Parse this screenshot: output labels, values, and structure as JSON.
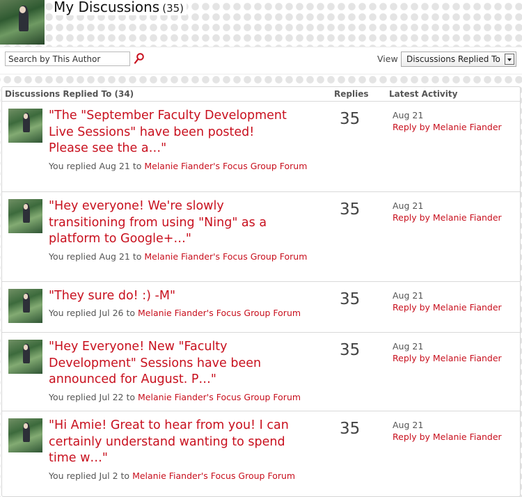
{
  "header": {
    "title": "My Discussions",
    "count": "(35)"
  },
  "toolbar": {
    "search_placeholder": "Search by This Author",
    "view_label": "View",
    "view_selected": "Discussions Replied To"
  },
  "table": {
    "header_topic": "Discussions Replied To (34)",
    "header_replies": "Replies",
    "header_activity": "Latest Activity"
  },
  "rows": [
    {
      "title_lines": [
        "\"The \"September Faculty Development",
        "Live Sessions\" have been posted!",
        "Please see the a…\""
      ],
      "meta_prefix": "You replied Aug 21 to ",
      "forum": "Melanie Fiander's Focus Group Forum",
      "replies": "35",
      "activity_date": "Aug 21",
      "activity_reply": "Reply by Melanie Fiander"
    },
    {
      "title_lines": [
        "\"Hey everyone! We're slowly",
        "transitioning from using \"Ning\" as a",
        "platform to Google+…\""
      ],
      "meta_prefix": "You replied Aug 21 to ",
      "forum": "Melanie Fiander's Focus Group Forum",
      "replies": "35",
      "activity_date": "Aug 21",
      "activity_reply": "Reply by Melanie Fiander"
    },
    {
      "title_lines": [
        "\"They sure do! :) -M\""
      ],
      "meta_prefix": "You replied Jul 26 to ",
      "forum": "Melanie Fiander's Focus Group Forum",
      "replies": "35",
      "activity_date": "Aug 21",
      "activity_reply": "Reply by Melanie Fiander"
    },
    {
      "title_lines": [
        "\"Hey Everyone! New \"Faculty",
        "Development\" Sessions have been",
        "announced for August.  P…\""
      ],
      "meta_prefix": "You replied Jul 22 to ",
      "forum": "Melanie Fiander's Focus Group Forum",
      "replies": "35",
      "activity_date": "Aug 21",
      "activity_reply": "Reply by Melanie Fiander"
    },
    {
      "title_lines": [
        "\"Hi Amie! Great to hear from you! I can",
        "certainly understand wanting to spend",
        "time w…\""
      ],
      "meta_prefix": "You replied Jul 2 to ",
      "forum": "Melanie Fiander's Focus Group Forum",
      "replies": "35",
      "activity_date": "Aug 21",
      "activity_reply": "Reply by Melanie Fiander"
    }
  ],
  "colors": {
    "link_red": "#c8101e",
    "text_gray": "#555555"
  },
  "icons": {
    "search": "search-icon",
    "dropdown": "chevron-down-icon"
  }
}
